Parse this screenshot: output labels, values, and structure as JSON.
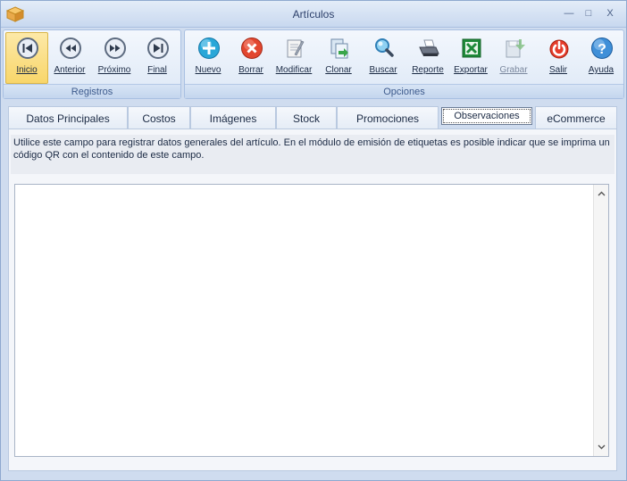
{
  "window": {
    "title": "Artículos",
    "minimize_glyph": "—",
    "maximize_glyph": "□",
    "close_glyph": "X"
  },
  "ribbon": {
    "registros": {
      "label": "Registros",
      "buttons": [
        {
          "label": "Inicio",
          "icon": "first-record-icon"
        },
        {
          "label": "Anterior",
          "icon": "previous-record-icon"
        },
        {
          "label": "Próximo",
          "icon": "next-record-icon"
        },
        {
          "label": "Final",
          "icon": "last-record-icon"
        }
      ]
    },
    "opciones": {
      "label": "Opciones",
      "buttons": [
        {
          "label": "Nuevo",
          "icon": "add-icon"
        },
        {
          "label": "Borrar",
          "icon": "delete-icon"
        },
        {
          "label": "Modificar",
          "icon": "edit-icon"
        },
        {
          "label": "Clonar",
          "icon": "clone-icon"
        },
        {
          "label": "Buscar",
          "icon": "search-icon"
        },
        {
          "label": "Reporte",
          "icon": "printer-icon"
        },
        {
          "label": "Exportar",
          "icon": "excel-icon"
        },
        {
          "label": "Grabar",
          "icon": "save-icon"
        },
        {
          "label": "Salir",
          "icon": "power-icon"
        },
        {
          "label": "Ayuda",
          "icon": "help-icon"
        }
      ]
    }
  },
  "tabs": [
    {
      "label": "Datos Principales"
    },
    {
      "label": "Costos"
    },
    {
      "label": "Imágenes"
    },
    {
      "label": "Stock"
    },
    {
      "label": "Promociones"
    },
    {
      "label": "Observaciones"
    },
    {
      "label": "eCommerce"
    }
  ],
  "observaciones": {
    "description": "Utilice este campo para registrar datos generales del artículo.  En el módulo de emisión de etiquetas es posible indicar que se imprima un código QR con el contenido de este campo.",
    "memo_value": "",
    "scroll_up_glyph": "^",
    "scroll_down_glyph": "v"
  },
  "colors": {
    "accent": "#f8d66a",
    "ribbon_border": "#a9c0e2",
    "window_bg": "#cfdcef"
  }
}
